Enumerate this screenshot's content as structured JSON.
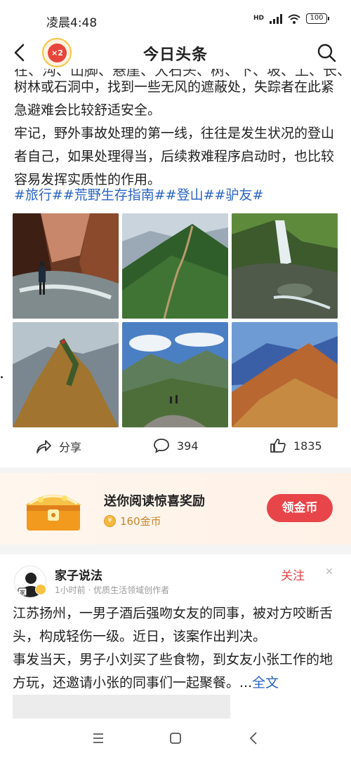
{
  "status_bar": {
    "time": "凌晨4:48",
    "network": "HD",
    "battery": "100"
  },
  "nav": {
    "title": "今日头条",
    "badge": "×2"
  },
  "article": {
    "clipped_line": "在、沟、山脚、悬崖、大石头、树、下、坡、上、长、岩",
    "paragraphs": [
      "树林或石洞中，找到一些无风的遮蔽处，失踪者在此紧急避难会比较舒适安全。",
      "牢记，野外事故处理的第一线，往往是发生状况的登山者自己，如果处理得当，后续救难程序启动时，也比较容易发挥实质性的作用。"
    ],
    "tags": "#旅行##荒野生存指南##登山##驴友#"
  },
  "actions": {
    "share": "分享",
    "comments": "394",
    "likes": "1835"
  },
  "reward": {
    "title": "送你阅读惊喜奖励",
    "coins": "160金币",
    "button": "领金币",
    "coin_glyph": "¥"
  },
  "next_post": {
    "author": "家子说法",
    "avatar_text": "家",
    "meta": "1小时前 · 优质生活领域创作者",
    "follow": "关注",
    "close": "✕",
    "paragraphs": [
      "江苏扬州，一男子酒后强吻女友的同事，被对方咬断舌头，构成轻伤一级。近日，该案作出判决。",
      "事发当天，男子小刘买了些食物，到女友小张工作的地方玩，还邀请小张的同事们一起聚餐。..."
    ],
    "more": "全文"
  },
  "bottom_nav": {
    "menu": "menu-icon",
    "home": "home-icon",
    "back": "back-icon"
  },
  "colors": {
    "link": "#2a64c4",
    "accent": "#e8454a",
    "coin": "#c9852b"
  }
}
